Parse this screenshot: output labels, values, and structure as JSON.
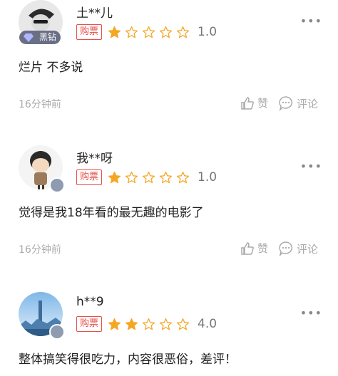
{
  "reviews": [
    {
      "username": "土**儿",
      "badge": "黑钻",
      "tag": "购票",
      "stars_filled": 1,
      "score": "1.0",
      "comment": "烂片 不多说",
      "time": "16分钟前",
      "like_label": "赞",
      "reply_label": "评论"
    },
    {
      "username": "我**呀",
      "tag": "购票",
      "stars_filled": 1,
      "score": "1.0",
      "comment": "觉得是我18年看的最无趣的电影了",
      "time": "16分钟前",
      "like_label": "赞",
      "reply_label": "评论"
    },
    {
      "username": "h**9",
      "tag": "购票",
      "stars_filled": 2,
      "score": "4.0",
      "comment": "整体搞笑得很吃力，内容很恶俗，差评！"
    }
  ],
  "colors": {
    "star_filled": "#f5a623",
    "star_empty": "#f5a623",
    "tag": "#e6504a"
  },
  "icons": {
    "like": "thumb-up-icon",
    "reply": "speech-bubble-icon",
    "more": "ellipsis-icon"
  }
}
